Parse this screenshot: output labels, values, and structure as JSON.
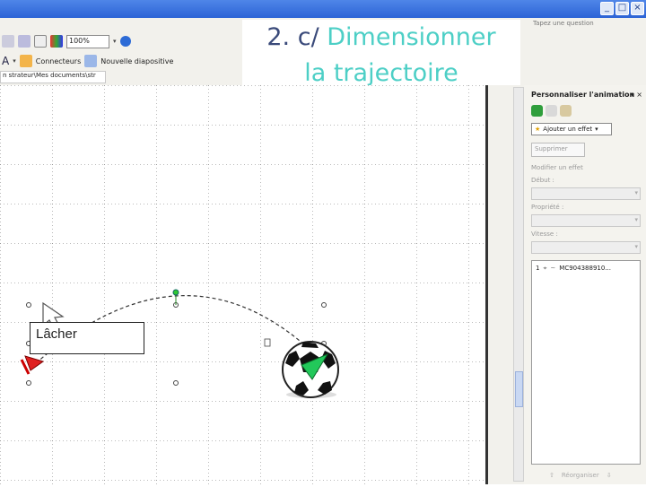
{
  "slide": {
    "title_num": "2. ",
    "title_letter": "c/",
    "title_line1": " Dimensionner",
    "title_line2": "la trajectoire",
    "textbox_label": "Lâcher"
  },
  "toolbar": {
    "zoom_value": "100%",
    "connectors_label": "Connecteurs",
    "new_slide_label": "Nouvelle diapositive",
    "path_text": "n strateur\\Mes documents\\str"
  },
  "help": {
    "placeholder": "Tapez une question"
  },
  "window_buttons": [
    "_",
    "□",
    "×"
  ],
  "task_pane": {
    "title": "Personnaliser l'animation",
    "add_effect": "Ajouter un effet",
    "remove": "Supprimer",
    "modify_label": "Modifier un effet",
    "start_label": "Début :",
    "property_label": "Propriété :",
    "speed_label": "Vitesse :",
    "list_item_number": "1",
    "list_item_text": "MC904388910...",
    "reorder_label": "Réorganiser"
  },
  "colors": {
    "title_blue": "#3a4a7a",
    "title_cyan": "#4dcfc6",
    "motion_end": "#e02020",
    "motion_start": "#22c85a"
  }
}
